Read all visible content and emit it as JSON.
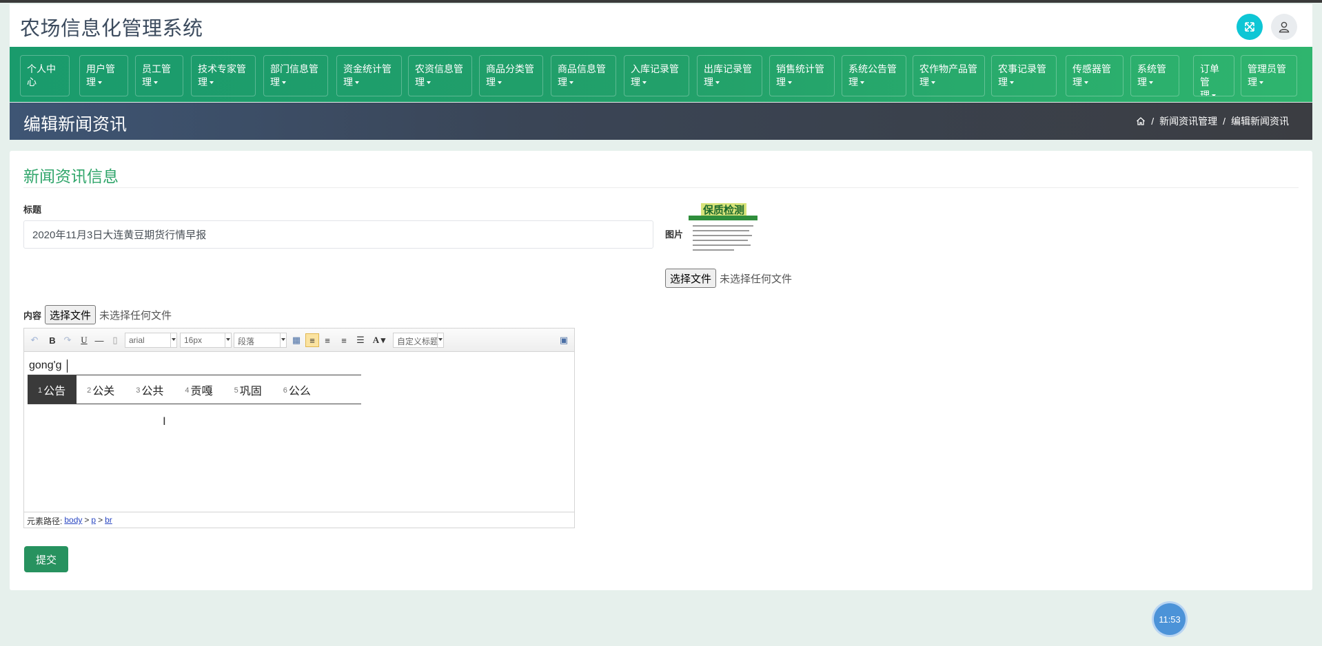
{
  "header": {
    "app_title": "农场信息化管理系统",
    "expand_icon": "expand-icon",
    "user_icon": "user-icon"
  },
  "nav": {
    "items": [
      {
        "line1": "个人中",
        "line2": "心",
        "caret": false
      },
      {
        "line1": "用户管",
        "line2": "理",
        "caret": true
      },
      {
        "line1": "员工管",
        "line2": "理",
        "caret": true
      },
      {
        "line1": "技术专家管",
        "line2": "理",
        "caret": true
      },
      {
        "line1": "部门信息管",
        "line2": "理",
        "caret": true
      },
      {
        "line1": "资金统计管",
        "line2": "理",
        "caret": true
      },
      {
        "line1": "农资信息管",
        "line2": "理",
        "caret": true
      },
      {
        "line1": "商品分类管",
        "line2": "理",
        "caret": true
      },
      {
        "line1": "商品信息管",
        "line2": "理",
        "caret": true
      },
      {
        "line1": "入库记录管",
        "line2": "理",
        "caret": true
      },
      {
        "line1": "出库记录管",
        "line2": "理",
        "caret": true
      },
      {
        "line1": "销售统计管",
        "line2": "理",
        "caret": true
      },
      {
        "line1": "系统公告管",
        "line2": "理",
        "caret": true
      },
      {
        "line1": "农作物产品管",
        "line2": "理",
        "caret": true
      },
      {
        "line1": "农事记录管",
        "line2": "理",
        "caret": true
      },
      {
        "line1": "传感器管",
        "line2": "理",
        "caret": true
      },
      {
        "line1": "系统管",
        "line2": "理",
        "caret": true
      },
      {
        "line1": "订单管",
        "line2": "理",
        "caret": true
      },
      {
        "line1": "管理员管",
        "line2": "理",
        "caret": true
      }
    ]
  },
  "pagebar": {
    "title": "编辑新闻资讯",
    "breadcrumb": [
      "新闻资讯管理",
      "编辑新闻资讯"
    ],
    "separator": "/"
  },
  "form": {
    "section_title": "新闻资讯信息",
    "title_label": "标题",
    "title_value": "2020年11月3日大连黄豆期货行情早报",
    "image_label": "图片",
    "image_heading": "保质检测",
    "image_file_button": "选择文件",
    "image_file_status": "未选择任何文件",
    "content_label": "内容",
    "content_file_button": "选择文件",
    "content_file_status": "未选择任何文件",
    "submit_label": "提交"
  },
  "editor": {
    "font_family": "arial",
    "font_size": "16px",
    "paragraph": "段落",
    "custom_title": "自定义标题",
    "typed_text": "gong'g",
    "ime_candidates": [
      {
        "num": "1",
        "text": "公告",
        "selected": true
      },
      {
        "num": "2",
        "text": "公关",
        "selected": false
      },
      {
        "num": "3",
        "text": "公共",
        "selected": false
      },
      {
        "num": "4",
        "text": "贡嘎",
        "selected": false
      },
      {
        "num": "5",
        "text": "巩固",
        "selected": false
      },
      {
        "num": "6",
        "text": "公么",
        "selected": false
      }
    ],
    "path_label": "元素路径:",
    "path": [
      "body",
      "p",
      "br"
    ],
    "path_sep": ">"
  },
  "clock": {
    "time": "11:53"
  },
  "colors": {
    "nav_green": "#22a06a",
    "accent_teal": "#0ec6d5",
    "section_green": "#2fa56a",
    "submit_green": "#27925f"
  }
}
